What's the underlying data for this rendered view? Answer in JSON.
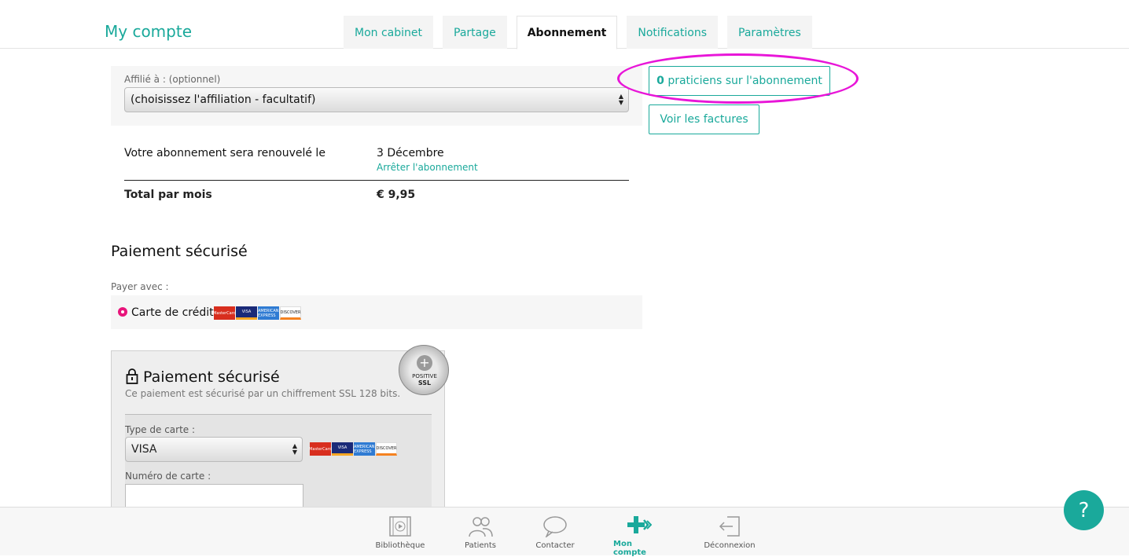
{
  "header": {
    "title": "My compte",
    "tabs": [
      {
        "label": "Mon cabinet"
      },
      {
        "label": "Partage"
      },
      {
        "label": "Abonnement"
      },
      {
        "label": "Notifications"
      },
      {
        "label": "Paramètres"
      }
    ]
  },
  "affiliation": {
    "label": "Affilié à : (optionnel)",
    "selected": "(choisissez l'affiliation - facultatif)"
  },
  "subscription": {
    "renew_label": "Votre abonnement sera renouvelé le",
    "renew_date": "3 Décembre",
    "stop_link": "Arrêter l'abonnement",
    "total_label": "Total par mois",
    "total_value": "€ 9,95"
  },
  "actions": {
    "practitioners_count": "0",
    "practitioners_label": " praticiens sur l'abonnement",
    "invoices_label": "Voir les factures"
  },
  "payment": {
    "section_title": "Paiement sécurisé",
    "pay_with": "Payer avec :",
    "method_label": "Carte de crédit",
    "secure_title": "Paiement sécurisé",
    "secure_sub": "Ce paiement est sécurisé par un chiffrement SSL 128 bits.",
    "card_type_label": "Type de carte :",
    "card_type_value": "VISA",
    "card_number_label": "Numéro de carte :",
    "card_number_value": ""
  },
  "ssl_badge": {
    "line1": "POSITIVE",
    "line2": "SSL"
  },
  "cards": {
    "mc": "MasterCard",
    "visa": "VISA",
    "amex": "AMERICAN EXPRESS",
    "disc": "DISCOVER"
  },
  "bottom_nav": [
    {
      "label": "Bibliothèque",
      "icon": "library-icon"
    },
    {
      "label": "Patients",
      "icon": "patients-icon"
    },
    {
      "label": "Contacter",
      "icon": "chat-icon"
    },
    {
      "label": "Mon compte",
      "icon": "medical-cross-icon"
    },
    {
      "label": "Déconnexion",
      "icon": "logout-icon"
    }
  ],
  "help_label": "?",
  "colors": {
    "accent": "#1aa99b",
    "highlight": "#e815d8",
    "radio": "#e8157b"
  }
}
